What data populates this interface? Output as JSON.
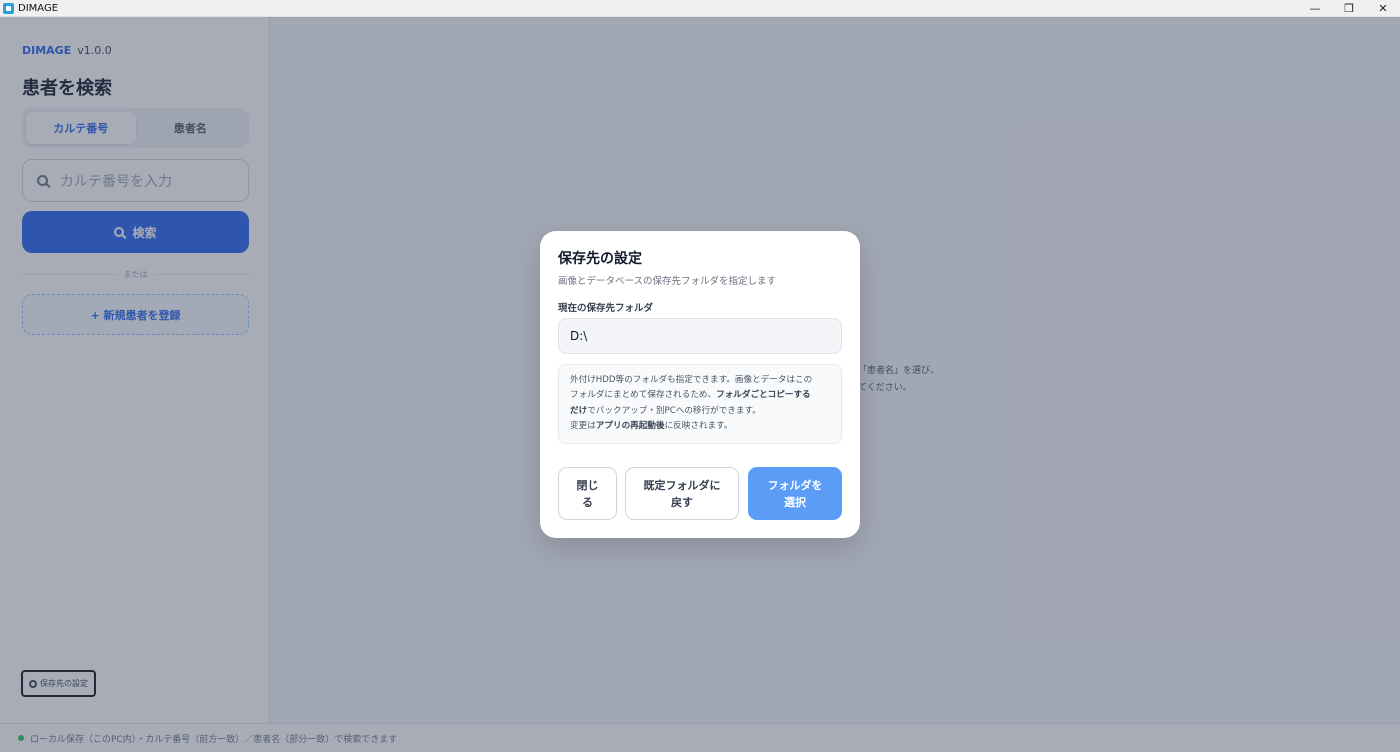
{
  "window": {
    "title": "DIMAGE",
    "minimize": "—",
    "maximize": "❐",
    "close": "✕"
  },
  "sidebar": {
    "brand_name": "DIMAGE",
    "version": "v1.0.0",
    "heading": "患者を検索",
    "tabs": [
      {
        "label": "カルテ番号",
        "active": true
      },
      {
        "label": "患者名",
        "active": false
      }
    ],
    "search_placeholder": "カルテ番号を入力",
    "search_button": "検索",
    "divider_text": "または",
    "new_patient_button": "+ 新規患者を登録",
    "settings_button": "保存先の設定"
  },
  "main": {
    "hint_line1": "「患者名」を選び、",
    "hint_line2": "てください。"
  },
  "statusbar": {
    "text": "ローカル保存（このPC内）・カルテ番号（前方一致）／患者名（部分一致）で検索できます"
  },
  "modal": {
    "title": "保存先の設定",
    "subtitle": "画像とデータベースの保存先フォルダを指定します",
    "field_label": "現在の保存先フォルダ",
    "current_path": "D:\\",
    "info": {
      "line1": "外付けHDD等のフォルダも指定できます。画像とデータはこの",
      "line2_a": "フォルダにまとめて保存されるため、",
      "line2_b": "フォルダごとコピーする",
      "line3_a": "だけ",
      "line3_b": "でバックアップ・別PCへの移行ができます。",
      "line4_a": "変更は",
      "line4_b": "アプリの再起動後",
      "line4_c": "に反映されます。"
    },
    "buttons": {
      "close_l1": "閉じ",
      "close_l2": "る",
      "default_l1": "既定フォルダに",
      "default_l2": "戻す",
      "select_l1": "フォルダを",
      "select_l2": "選択"
    }
  },
  "colors": {
    "accent": "#2563eb",
    "primary_button": "#5b9cf7",
    "status_ok": "#22c55e"
  }
}
